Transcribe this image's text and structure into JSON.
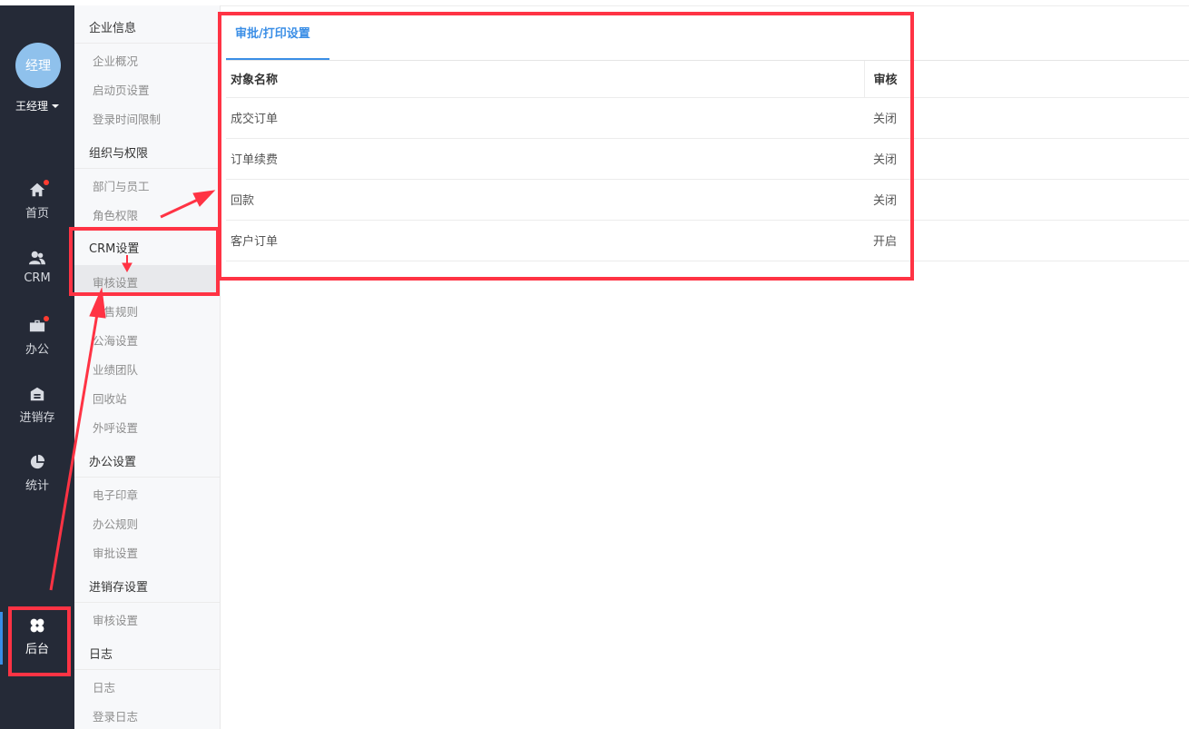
{
  "user": {
    "avatar_text": "经理",
    "name": "王经理"
  },
  "nav": {
    "items": [
      {
        "label": "首页",
        "icon": "home-icon",
        "badge": true
      },
      {
        "label": "CRM",
        "icon": "users-icon",
        "badge": false
      },
      {
        "label": "办公",
        "icon": "briefcase-icon",
        "badge": true
      },
      {
        "label": "进销存",
        "icon": "warehouse-icon",
        "badge": false
      },
      {
        "label": "统计",
        "icon": "pie-chart-icon",
        "badge": false
      },
      {
        "label": "后台",
        "icon": "clover-icon",
        "badge": false,
        "active": true
      }
    ]
  },
  "submenu": {
    "groups": [
      {
        "title": "企业信息",
        "items": [
          "企业概况",
          "启动页设置",
          "登录时间限制"
        ]
      },
      {
        "title": "组织与权限",
        "items": [
          "部门与员工",
          "角色权限"
        ]
      },
      {
        "title": "CRM设置",
        "items": [
          "审核设置",
          "销售规则",
          "公海设置",
          "业绩团队",
          "回收站",
          "外呼设置"
        ]
      },
      {
        "title": "办公设置",
        "items": [
          "电子印章",
          "办公规则",
          "审批设置"
        ]
      },
      {
        "title": "进销存设置",
        "items": [
          "审核设置"
        ]
      },
      {
        "title": "日志",
        "items": [
          "日志",
          "登录日志"
        ]
      }
    ],
    "selected": "审核设置"
  },
  "main": {
    "tab_label": "审批/打印设置",
    "table": {
      "headers": [
        "对象名称",
        "审核"
      ],
      "rows": [
        [
          "成交订单",
          "关闭"
        ],
        [
          "订单续费",
          "关闭"
        ],
        [
          "回款",
          "关闭"
        ],
        [
          "客户订单",
          "开启"
        ]
      ]
    }
  },
  "colors": {
    "nav_bg": "#252a37",
    "accent": "#3a8ee6",
    "annotation": "#ff3344"
  }
}
